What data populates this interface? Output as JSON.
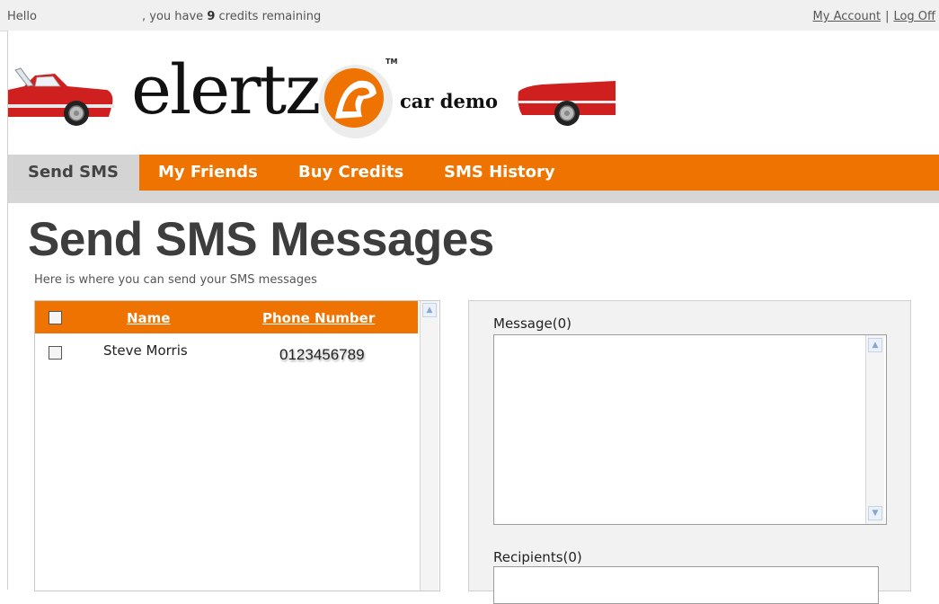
{
  "topbar": {
    "hello": "Hello",
    "credits_prefix": ", you have",
    "credits_count": "9",
    "credits_suffix": "credits remaining",
    "my_account": "My Account",
    "separator": "|",
    "log_off": "Log Off"
  },
  "header": {
    "logo_text": "elertz",
    "tm": "TM",
    "subtitle": "car demo"
  },
  "nav": {
    "tabs": [
      {
        "label": "Send SMS",
        "active": true
      },
      {
        "label": "My Friends",
        "active": false
      },
      {
        "label": "Buy Credits",
        "active": false
      },
      {
        "label": "SMS History",
        "active": false
      }
    ]
  },
  "page": {
    "title": "Send SMS Messages",
    "subtitle": "Here is where you can send your SMS messages"
  },
  "friends_table": {
    "columns": [
      "Name",
      "Phone Number"
    ],
    "rows": [
      {
        "name": "Steve Morris",
        "phone": "0123456789",
        "checked": false
      }
    ]
  },
  "message_panel": {
    "message_label": "Message(0)",
    "message_value": "",
    "recipients_label": "Recipients(0)"
  },
  "colors": {
    "accent": "#ef7300",
    "nav_active": "#d4d4d4",
    "car_red": "#d01f1f"
  }
}
